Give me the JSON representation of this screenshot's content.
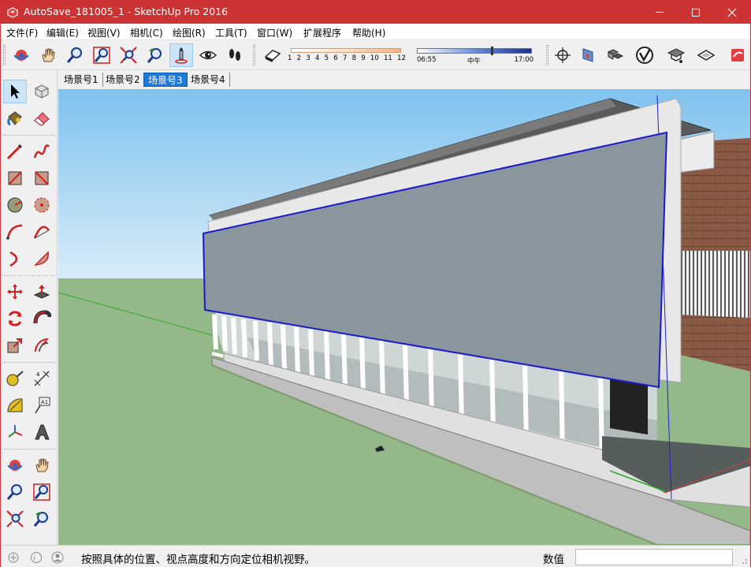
{
  "window": {
    "title": "AutoSave_181005_1 - SketchUp Pro 2016",
    "accent": "#cc3333"
  },
  "menu": [
    "文件(F)",
    "编辑(E)",
    "视图(V)",
    "相机(C)",
    "绘图(R)",
    "工具(T)",
    "窗口(W)",
    "扩展程序",
    "帮助(H)"
  ],
  "toolbar": {
    "shadow_ruler_months": [
      "1",
      "2",
      "3",
      "4",
      "5",
      "6",
      "7",
      "8",
      "9",
      "10",
      "11",
      "12"
    ],
    "time_start": "06:55",
    "time_mid": "中午",
    "time_end": "17:00"
  },
  "scenes": {
    "tabs": [
      "场景号1",
      "场景号2",
      "场景号3",
      "场景号4"
    ],
    "active_index": 2
  },
  "status": {
    "message": "按照具体的位置、视点高度和方向定位相机视野。",
    "vcb_label": "数值",
    "vcb_value": ""
  }
}
